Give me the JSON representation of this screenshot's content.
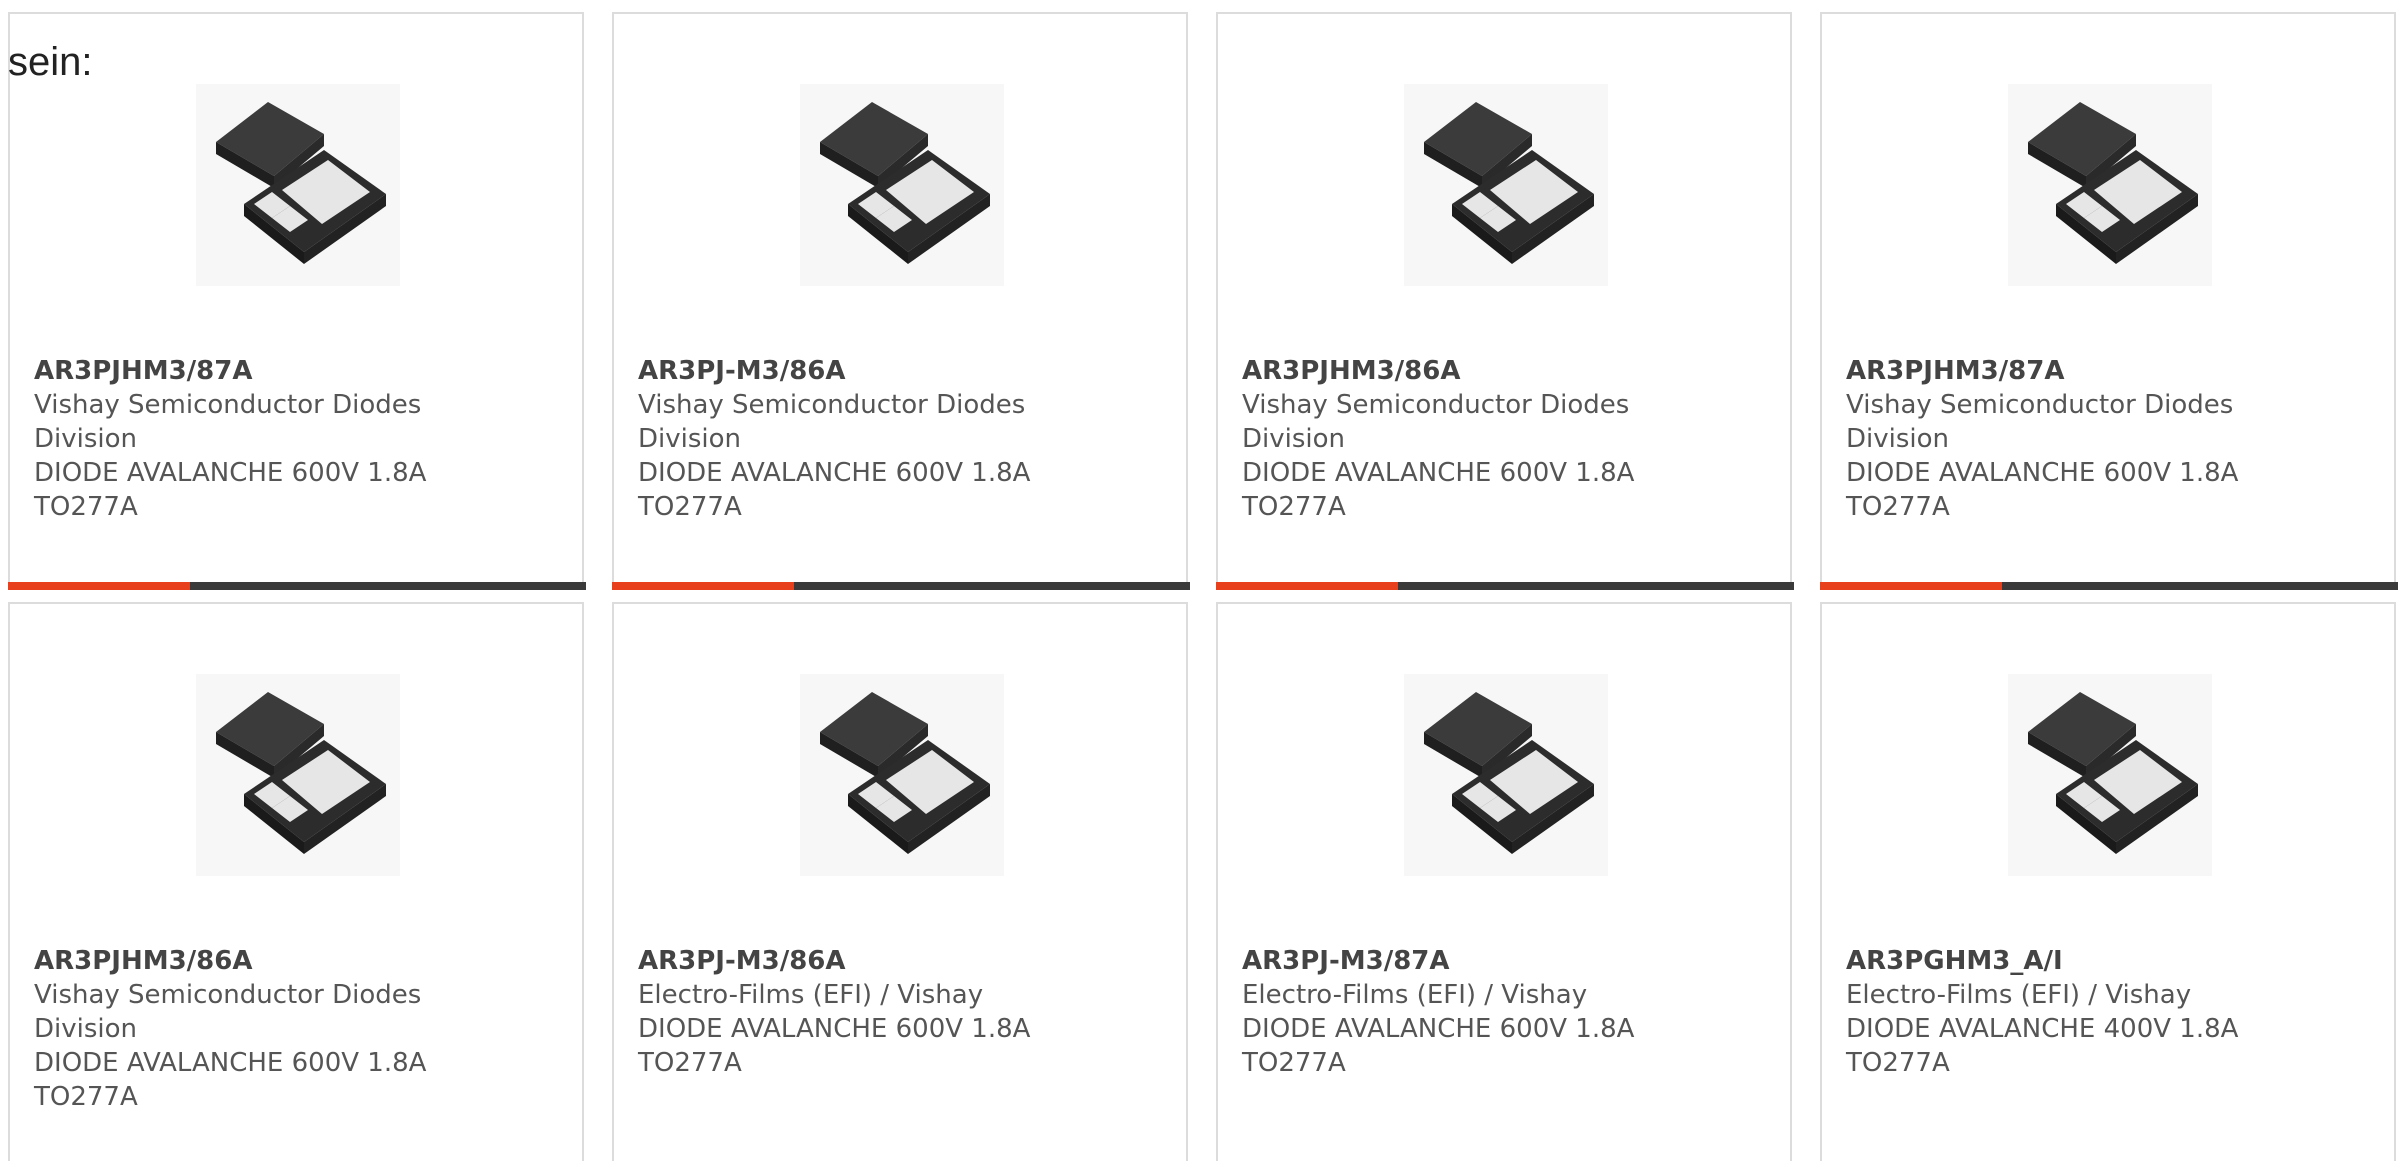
{
  "intro_text": "sein:",
  "colors": {
    "accent": "#e8401c",
    "bar_dark": "#3a3a3a",
    "border": "#dcdcdc"
  },
  "products": [
    {
      "part_number": "AR3PJHM3/87A",
      "manufacturer": "Vishay Semiconductor Diodes Division",
      "description": "DIODE AVALANCHE 600V 1.8A TO277A",
      "image_icon": "diode-package-icon"
    },
    {
      "part_number": "AR3PJ-M3/86A",
      "manufacturer": "Vishay Semiconductor Diodes Division",
      "description": "DIODE AVALANCHE 600V 1.8A TO277A",
      "image_icon": "diode-package-icon"
    },
    {
      "part_number": "AR3PJHM3/86A",
      "manufacturer": "Vishay Semiconductor Diodes Division",
      "description": "DIODE AVALANCHE 600V 1.8A TO277A",
      "image_icon": "diode-package-icon"
    },
    {
      "part_number": "AR3PJHM3/87A",
      "manufacturer": "Vishay Semiconductor Diodes Division",
      "description": "DIODE AVALANCHE 600V 1.8A TO277A",
      "image_icon": "diode-package-icon"
    },
    {
      "part_number": "AR3PJHM3/86A",
      "manufacturer": "Vishay Semiconductor Diodes Division",
      "description": "DIODE AVALANCHE 600V 1.8A TO277A",
      "image_icon": "diode-package-icon"
    },
    {
      "part_number": "AR3PJ-M3/86A",
      "manufacturer": "Electro-Films (EFI) / Vishay",
      "description": "DIODE AVALANCHE 600V 1.8A TO277A",
      "image_icon": "diode-package-icon"
    },
    {
      "part_number": "AR3PJ-M3/87A",
      "manufacturer": "Electro-Films (EFI) / Vishay",
      "description": "DIODE AVALANCHE 600V 1.8A TO277A",
      "image_icon": "diode-package-icon"
    },
    {
      "part_number": "AR3PGHM3_A/I",
      "manufacturer": "Electro-Films (EFI) / Vishay",
      "description": "DIODE AVALANCHE 400V 1.8A TO277A",
      "image_icon": "diode-package-icon"
    }
  ]
}
